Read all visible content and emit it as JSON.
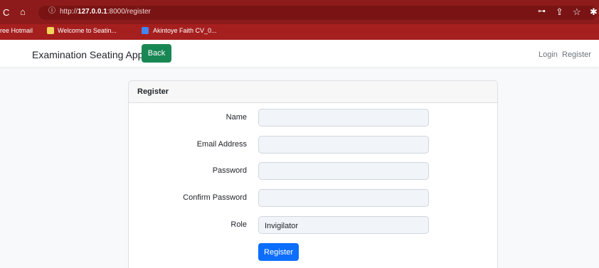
{
  "browser": {
    "url_scheme": "http://",
    "url_host": "127.0.0.1",
    "url_rest": ":8000/register",
    "bookmarks": [
      {
        "label": "ree Hotmail"
      },
      {
        "label": "Welcome to Seatin..."
      },
      {
        "label": "Akintoye Faith CV_0..."
      }
    ]
  },
  "navbar": {
    "brand": "Examination Seating App",
    "back_label": "Back",
    "login_label": "Login",
    "register_label": "Register"
  },
  "card": {
    "title": "Register",
    "fields": {
      "name_label": "Name",
      "email_label": "Email Address",
      "password_label": "Password",
      "confirm_label": "Confirm Password",
      "role_label": "Role",
      "role_value": "Invigilator"
    },
    "submit_label": "Register"
  },
  "colors": {
    "chrome": "#8e1b1b",
    "back_button": "#198754",
    "submit_button": "#0d6efd"
  }
}
